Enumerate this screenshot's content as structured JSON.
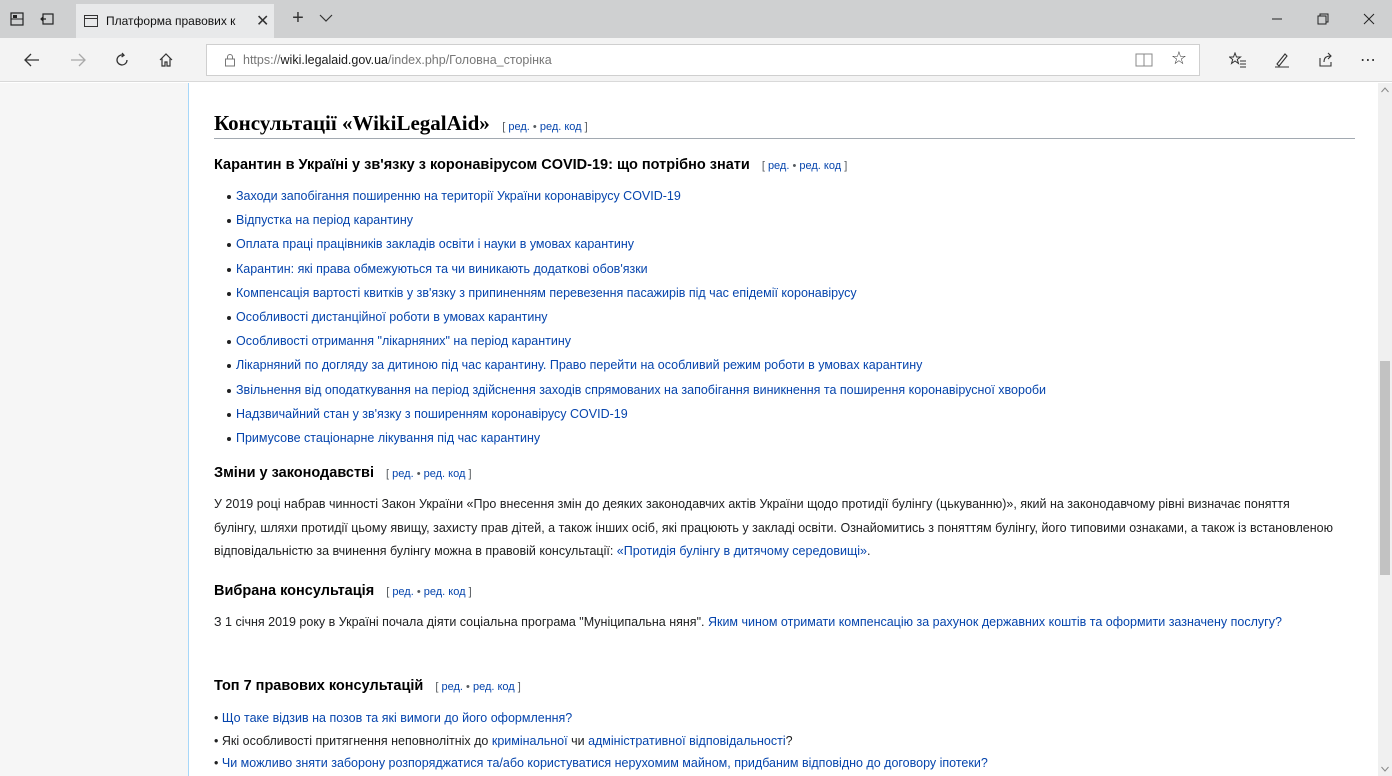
{
  "browser": {
    "tab_title": "Платформа правових к",
    "url_prefix": "https://",
    "url_host": "wiki.legalaid.gov.ua",
    "url_path": "/index.php/Головна_сторінка",
    "icons": [
      "tabs-aside-icon",
      "back-tabs-icon",
      "page-icon",
      "close-icon",
      "plus-icon",
      "chevron-down-icon",
      "minimize-icon",
      "restore-icon",
      "close-icon",
      "back-arrow-icon",
      "forward-arrow-icon",
      "refresh-icon",
      "home-icon",
      "lock-icon",
      "reading-view-icon",
      "star-icon",
      "favorites-icon",
      "pen-icon",
      "share-icon",
      "more-icon"
    ]
  },
  "edit_links": {
    "open": "[",
    "edit": "ред.",
    "sep": "•",
    "source": "ред. код",
    "close": "]"
  },
  "page": {
    "heading": "Консультації «WikiLegalAid»",
    "quarantine": {
      "heading": "Карантин в Україні у зв'язку з коронавірусом COVID-19: що потрібно знати",
      "items": [
        "Заходи запобігання поширенню на території України коронавірусу COVID-19",
        "Відпустка на період карантину",
        "Оплата праці працівників закладів освіти і науки в умовах карантину",
        "Карантин: які права обмежуються та чи виникають додаткові обов'язки",
        "Компенсація вартості квитків у зв'язку з припиненням перевезення пасажирів під час епідемії коронавірусу",
        "Особливості дистанційної роботи в умовах карантину",
        "Особливості отримання \"лікарняних\" на період карантину",
        "Лікарняний по догляду за дитиною під час карантину. Право перейти на особливий режим роботи в умовах карантину",
        "Звільнення від оподаткування на період здійснення заходів спрямованих на запобігання виникнення та поширення коронавірусної хвороби",
        "Надзвичайний стан у зв'язку з поширенням коронавірусу COVID-19",
        "Примусове стаціонарне лікування під час карантину"
      ]
    },
    "legislation": {
      "heading": "Зміни у законодавстві",
      "text": "У 2019 році набрав чинності Закон України «Про внесення змін до деяких законодавчих актів України щодо протидії булінгу (цькуванню)», який на законодавчому рівні визначає поняття булінгу, шляхи протидії цьому явищу, захисту прав дітей, а також інших осіб, які працюють у закладі освіти. Ознайомитись з поняттям булінгу, його типовими ознаками, а також із встановленою відповідальністю за вчинення булінгу можна в правовій консультації: ",
      "link": "«Протидія булінгу в дитячому середовищі»",
      "end": "."
    },
    "featured": {
      "heading": "Вибрана консультація",
      "text": "З 1 січня 2019 року в Україні почала діяти соціальна програма \"Муніципальна няня\". ",
      "link": "Яким чином отримати компенсацію за рахунок державних коштів та оформити зазначену послугу?"
    },
    "top7": {
      "heading": "Топ 7 правових консультацій",
      "bullet": "•",
      "item1_link": "Що таке відзив на позов та які вимоги до його оформлення?",
      "item2_pre": "Які особливості притягнення неповнолітніх до ",
      "item2_link1": "кримінальної",
      "item2_mid": " чи ",
      "item2_link2": "адміністративної відповідальності",
      "item2_end": "?",
      "item3_link": "Чи можливо зняти заборону розпоряджатися та/або користуватися нерухомим майном, придбаним відповідно до договору іпотеки?"
    }
  },
  "colors": {
    "link": "#0645ad",
    "titlebar": "#cfd0d1",
    "navbar": "#f3f3f3",
    "content_border": "#a7d7f9"
  }
}
